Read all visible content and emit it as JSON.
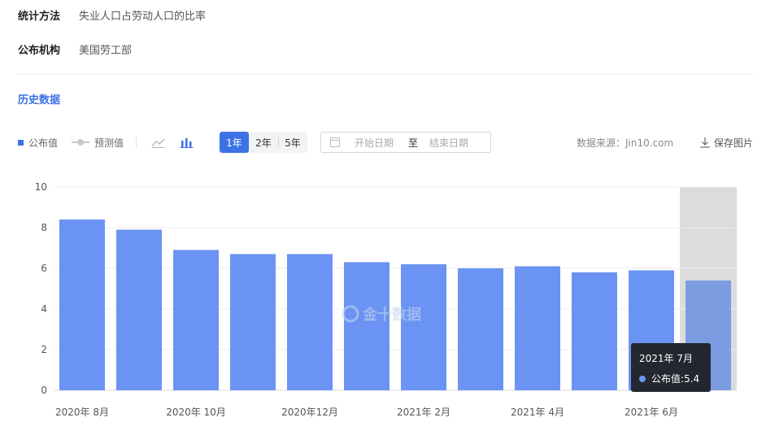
{
  "meta": {
    "method_label": "统计方法",
    "method_value": "失业人口占劳动人口的比率",
    "agency_label": "公布机构",
    "agency_value": "美国劳工部"
  },
  "section_title": "历史数据",
  "toolbar": {
    "legend_published": "公布值",
    "legend_forecast": "预测值",
    "range_buttons": [
      "1年",
      "2年",
      "5年"
    ],
    "active_range": "1年",
    "start_date_placeholder": "开始日期",
    "date_separator": "至",
    "end_date_placeholder": "结束日期",
    "source": "数据来源：Jin10.com",
    "save_label": "保存图片"
  },
  "watermark": "金十数据",
  "colors": {
    "accent": "#3c72e6",
    "bar": "#6b93f3",
    "bar_highlight": "#7c9ce2",
    "hover_band": "#dcdcdc",
    "tooltip_bg": "#23272f"
  },
  "chart_data": {
    "type": "bar",
    "categories": [
      "2020年 8月",
      "2020年 9月",
      "2020年 10月",
      "2020年 11月",
      "2020年12月",
      "2021年 1月",
      "2021年 2月",
      "2021年 3月",
      "2021年 4月",
      "2021年 5月",
      "2021年 6月",
      "2021年 7月"
    ],
    "x_tick_labels": [
      "2020年 8月",
      "",
      "2020年 10月",
      "",
      "2020年12月",
      "",
      "2021年 2月",
      "",
      "2021年 4月",
      "",
      "2021年 6月",
      ""
    ],
    "series": [
      {
        "name": "公布值",
        "values": [
          8.4,
          7.9,
          6.9,
          6.7,
          6.7,
          6.3,
          6.2,
          6.0,
          6.1,
          5.8,
          5.9,
          5.4
        ]
      }
    ],
    "ylim": [
      0,
      10
    ],
    "yticks": [
      0,
      2,
      4,
      6,
      8,
      10
    ],
    "grid": true,
    "highlighted_index": 11
  },
  "tooltip": {
    "title": "2021年 7月",
    "label": "公布值",
    "value": "5.4"
  }
}
